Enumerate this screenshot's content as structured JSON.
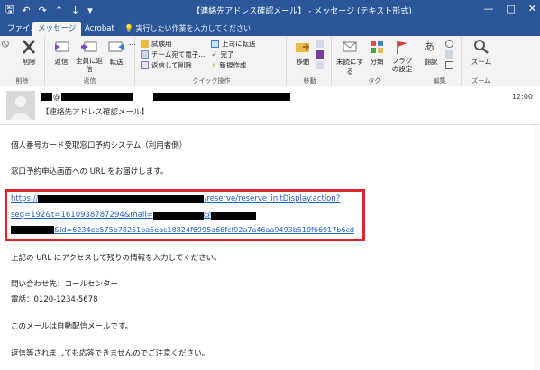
{
  "window": {
    "title": "【連絡先アドレス確認メール】 - メッセージ (テキスト形式)",
    "minimize": "—",
    "restore": "□",
    "close": "✕"
  },
  "tabs": [
    {
      "label": "ファイル"
    },
    {
      "label": "メッセージ"
    },
    {
      "label": "Acrobat"
    }
  ],
  "tell_me": "実行したい作業を入力してください",
  "ribbon": {
    "delete_group": {
      "label": "削除",
      "delete_button": "削除"
    },
    "respond_group": {
      "label": "返信",
      "reply": "返信",
      "reply_all": "全員に返信",
      "forward": "転送"
    },
    "quicksteps_group": {
      "label": "クイック操作",
      "items": [
        "試験用",
        "チーム宛て電子...",
        "返信して削除",
        "上司に転送",
        "完了",
        "新規作成"
      ]
    },
    "move_group": {
      "label": "移動",
      "move": "移動"
    },
    "tags_group": {
      "label": "タグ",
      "unread": "未読にする",
      "categorize": "分類",
      "followup": "フラグの設定"
    },
    "edit_group": {
      "label": "編集",
      "translate": "翻訳"
    },
    "zoom_group": {
      "label": "ズーム",
      "zoom": "ズーム"
    }
  },
  "message": {
    "sender_at": "@",
    "time": "12:00",
    "subject": "【連絡先アドレス確認メール】",
    "body": {
      "line1": "個人番号カード受取窓口予約システム（利用者側）",
      "line2": "窓口予約申込画面への URL をお届けします。",
      "link_line1_prefix": "https://",
      "link_line1_suffix": "/reserve/reserve_initDisplay.action?",
      "link_line2_prefix": "seq=192&t=1610938787294&mail=",
      "link_line2_at": "@",
      "link_line3_suffix": "&id=6234ee575b78251ba5eac18824f6995a66fcf92a7a46aa9493b510f66917b6cd",
      "line3": "上記の URL にアクセスして残りの情報を入力してください。",
      "line4": "問い合わせ先：コールセンター",
      "line5": "電話：0120-1234-5678",
      "line6": "このメールは自動配信メールです。",
      "line7": "返信等されましても応答できませんのでご注意ください。"
    }
  },
  "colors": {
    "accent": "#2b579a",
    "highlight_box": "#e0252b",
    "link": "#1f5fbf"
  }
}
